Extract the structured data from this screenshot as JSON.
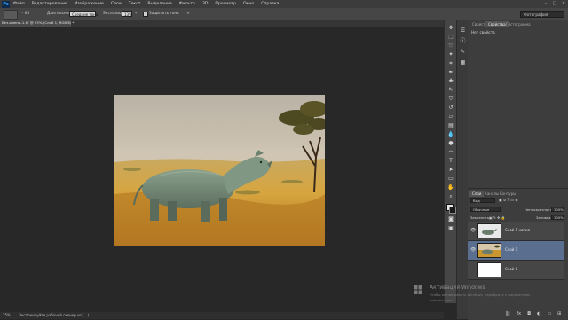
{
  "app": {
    "logo": "Ps"
  },
  "menu": [
    "Файл",
    "Редактирование",
    "Изображение",
    "Слои",
    "Текст",
    "Выделение",
    "Фильтр",
    "3D",
    "Просмотр",
    "Окно",
    "Справка"
  ],
  "options_bar": {
    "mode_label": "Длительность:",
    "mode_value": "Средние тона",
    "exposure_label": "Экспозиция:",
    "exposure_value": "13%",
    "protect_label": "Защитить тона",
    "workspace": "Фотография"
  },
  "document": {
    "tab_title": "Без-имени-1.tif @ 25% (Слой 1, RGB/8) *",
    "status_left": "25%",
    "status_text": "Экспонируйте рабочий сканер из (...)"
  },
  "properties_panel": {
    "tabs": [
      "Свойства",
      "Свойства",
      "Гистограмма"
    ],
    "title": "Нет свойств"
  },
  "layers_panel": {
    "tabs": [
      "Слои",
      "Каналы",
      "Контуры"
    ],
    "kind_filter": "Вид",
    "blend_mode": "Обычные",
    "opacity_label": "Непрозрачность:",
    "opacity_value": "100%",
    "lock_label": "Закрепить:",
    "fill_label": "Заливка:",
    "fill_value": "100%",
    "layers": [
      {
        "name": "Слой 1 копия",
        "visible": true,
        "selected": false
      },
      {
        "name": "Слой 1",
        "visible": true,
        "selected": true
      },
      {
        "name": "Слой 0",
        "visible": false,
        "selected": false
      }
    ]
  },
  "watermark": {
    "title": "Активация Windows",
    "line1": "Чтобы активировать Windows, перейдите к параметрам",
    "line2": "компьютера."
  },
  "colors": {
    "accent": "#5a6f8f",
    "chrome": "#3d3d3d",
    "workspace": "#282828"
  }
}
